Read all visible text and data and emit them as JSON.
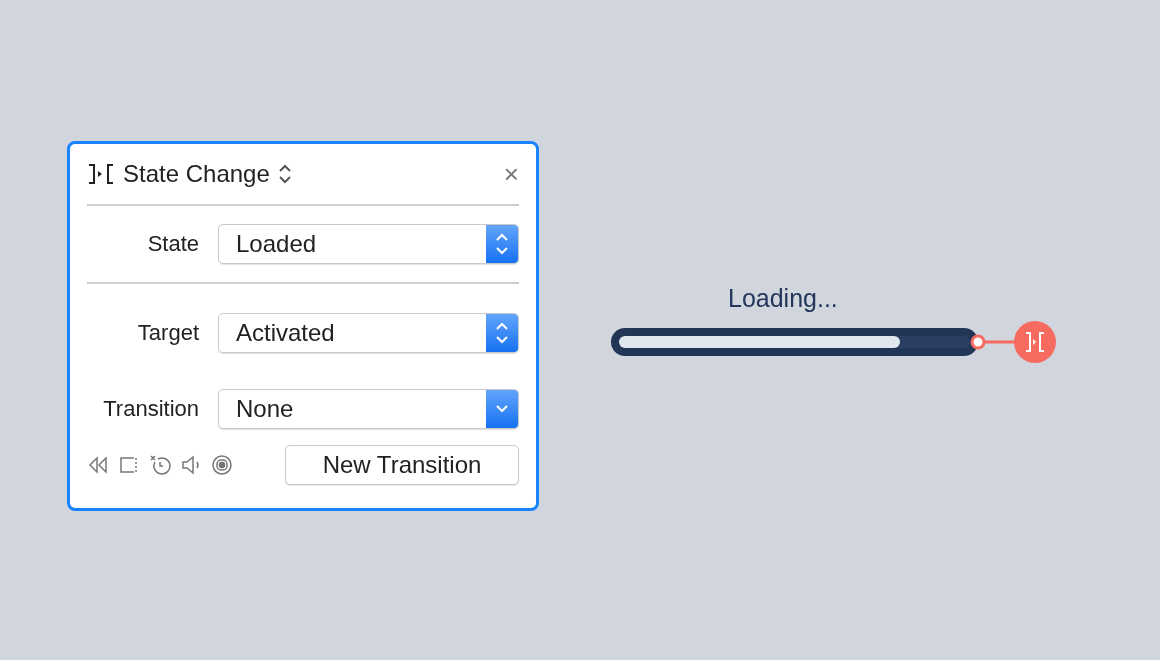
{
  "panel": {
    "title": "State Change",
    "close": "×",
    "fields": [
      {
        "label": "State",
        "value": "Loaded",
        "kind": "stepper",
        "divider_after": true
      },
      {
        "label": "Target",
        "value": "Activated",
        "kind": "stepper",
        "divider_after": false
      },
      {
        "label": "Transition",
        "value": "None",
        "kind": "popup",
        "divider_after": false
      }
    ],
    "button": "New Transition"
  },
  "progress": {
    "label": "Loading...",
    "level": 0.8
  }
}
